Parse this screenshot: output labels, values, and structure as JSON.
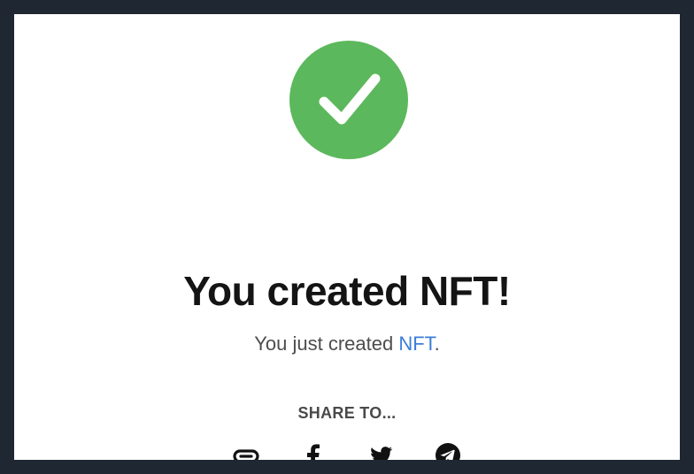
{
  "modal": {
    "title": "You created NFT!",
    "subtitle_prefix": "You just created ",
    "subtitle_link": "NFT",
    "subtitle_suffix": ".",
    "share_heading": "SHARE TO...",
    "share_options": [
      "copy-link",
      "facebook",
      "twitter",
      "telegram"
    ]
  },
  "colors": {
    "success": "#5cb85c",
    "link": "#3b7dd8",
    "backdrop": "#1f2733"
  },
  "icons": {
    "status": "checkmark-icon",
    "share": [
      "link-icon",
      "facebook-icon",
      "twitter-icon",
      "telegram-icon"
    ]
  }
}
